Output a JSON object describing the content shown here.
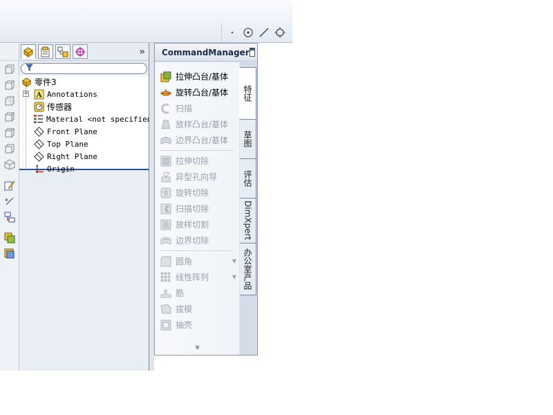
{
  "colors": {
    "accent": "#2a4f9c",
    "disabled_text": "#9aa0ab",
    "panel_bg": "#e9edf4"
  },
  "view_toolbar": {
    "icons": [
      "dot-icon",
      "point-icon",
      "line-icon",
      "circle-crosshair-icon"
    ]
  },
  "left_toolbar": {
    "icons": [
      "view-front-icon",
      "view-back-icon",
      "view-left-icon",
      "view-right-icon",
      "view-top-icon",
      "view-bottom-icon",
      "isometric-view-icon",
      "sketch-icon",
      "smart-dimension-icon",
      "relations-icon",
      "assembly-icon",
      "insert-component-icon"
    ]
  },
  "feature_manager": {
    "tabs": [
      "feature-manager-tab",
      "property-manager-tab",
      "configuration-manager-tab",
      "dimxpert-manager-tab"
    ],
    "expand_label": "»",
    "filter_icon": "filter-icon",
    "tree": {
      "root": "零件3",
      "items": [
        {
          "label": "Annotations",
          "icon": "annotations-icon",
          "expandable": true
        },
        {
          "label": "传感器",
          "icon": "sensor-icon",
          "expandable": false
        },
        {
          "label": "Material <not specified>",
          "icon": "material-icon",
          "expandable": false
        },
        {
          "label": "Front Plane",
          "icon": "plane-icon",
          "expandable": false
        },
        {
          "label": "Top Plane",
          "icon": "plane-icon",
          "expandable": false
        },
        {
          "label": "Right Plane",
          "icon": "plane-icon",
          "expandable": false
        },
        {
          "label": "Origin",
          "icon": "origin-icon",
          "expandable": false
        }
      ]
    }
  },
  "command_manager": {
    "title": "CommandManager",
    "groups": [
      [
        {
          "label": "拉伸凸台/基体",
          "enabled": true,
          "icon": "extruded-boss-icon"
        },
        {
          "label": "旋转凸台/基体",
          "enabled": true,
          "icon": "revolved-boss-icon"
        },
        {
          "label": "扫描",
          "enabled": false,
          "icon": "swept-boss-icon"
        },
        {
          "label": "放样凸台/基体",
          "enabled": false,
          "icon": "lofted-boss-icon"
        },
        {
          "label": "边界凸台/基体",
          "enabled": false,
          "icon": "boundary-boss-icon"
        }
      ],
      [
        {
          "label": "拉伸切除",
          "enabled": false,
          "icon": "extruded-cut-icon"
        },
        {
          "label": "异型孔向导",
          "enabled": false,
          "icon": "hole-wizard-icon"
        },
        {
          "label": "旋转切除",
          "enabled": false,
          "icon": "revolved-cut-icon"
        },
        {
          "label": "扫描切除",
          "enabled": false,
          "icon": "swept-cut-icon"
        },
        {
          "label": "放样切割",
          "enabled": false,
          "icon": "lofted-cut-icon"
        },
        {
          "label": "边界切除",
          "enabled": false,
          "icon": "boundary-cut-icon"
        }
      ],
      [
        {
          "label": "圆角",
          "enabled": false,
          "icon": "fillet-icon",
          "dropdown": true
        },
        {
          "label": "线性阵列",
          "enabled": false,
          "icon": "linear-pattern-icon",
          "dropdown": true
        },
        {
          "label": "筋",
          "enabled": false,
          "icon": "rib-icon"
        },
        {
          "label": "拔模",
          "enabled": false,
          "icon": "draft-icon"
        },
        {
          "label": "抽壳",
          "enabled": false,
          "icon": "shell-icon"
        }
      ]
    ],
    "more_label": "»",
    "tabs": [
      {
        "label": "特征",
        "active": true
      },
      {
        "label": "草图",
        "active": false
      },
      {
        "label": "评估",
        "active": false
      },
      {
        "label": "DimXpert",
        "active": false
      },
      {
        "label": "办公室产品",
        "active": false
      }
    ]
  }
}
